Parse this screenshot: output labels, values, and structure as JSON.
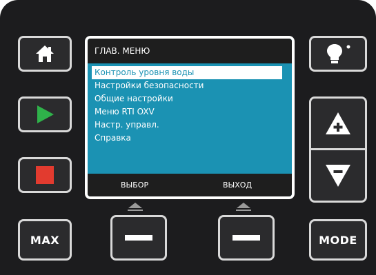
{
  "screen": {
    "title": "ГЛАВ. МЕНЮ",
    "menu_items": [
      "Контроль уровня воды",
      "Настройки безопасности",
      "Общие настройки",
      "Меню RTI OXV",
      "Настр. управл.",
      "Справка"
    ],
    "selected_index": 0,
    "softkey_left": "ВЫБОР",
    "softkey_right": "ВЫХОД"
  },
  "buttons": {
    "max_label": "MAX",
    "mode_label": "MODE"
  },
  "colors": {
    "screen_bg": "#1b92b3",
    "panel_bg": "#1c1c1e",
    "play": "#2fb24a",
    "stop": "#e23b2f"
  },
  "icons": {
    "home": "home-icon",
    "play": "play-icon",
    "stop": "stop-icon",
    "light": "bulb-icon",
    "up": "arrow-up-plus-icon",
    "down": "arrow-down-minus-icon",
    "softkey": "dash-icon"
  }
}
